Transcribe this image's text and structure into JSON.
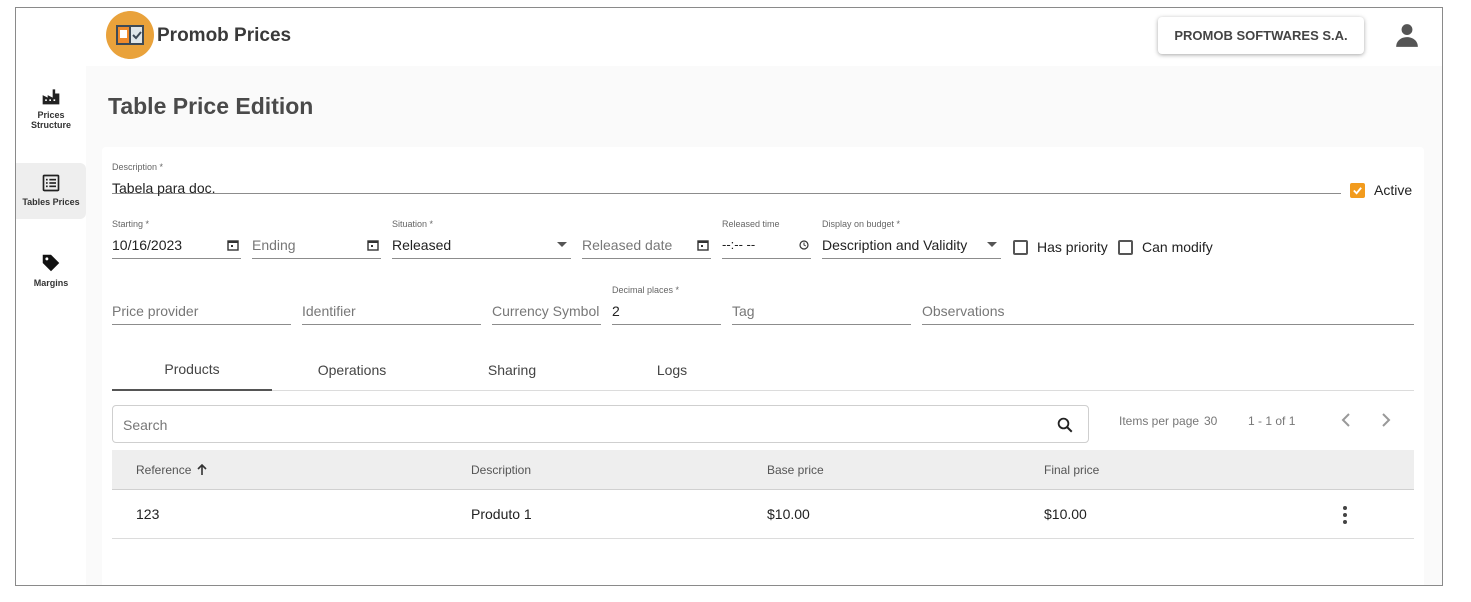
{
  "app": {
    "title": "Promob Prices",
    "company": "PROMOB SOFTWARES S.A."
  },
  "sidebar": {
    "items": [
      {
        "label": "Prices Structure",
        "icon": "factory-icon"
      },
      {
        "label": "Tables Prices",
        "icon": "list-icon"
      },
      {
        "label": "Margins",
        "icon": "tag-icon"
      }
    ]
  },
  "page": {
    "title": "Table Price Edition"
  },
  "form": {
    "description": {
      "label": "Description *",
      "value": "Tabela para doc."
    },
    "active": {
      "label": "Active",
      "checked": true
    },
    "starting": {
      "label": "Starting *",
      "value": "10/16/2023"
    },
    "ending": {
      "placeholder": "Ending"
    },
    "situation": {
      "label": "Situation *",
      "value": "Released"
    },
    "released_date": {
      "placeholder": "Released date"
    },
    "released_time": {
      "label": "Released time",
      "value": "--:-- --"
    },
    "display_on_budget": {
      "label": "Display on budget *",
      "value": "Description and Validity"
    },
    "has_priority": {
      "label": "Has priority",
      "checked": false
    },
    "can_modify": {
      "label": "Can modify",
      "checked": false
    },
    "price_provider": {
      "placeholder": "Price provider"
    },
    "identifier": {
      "placeholder": "Identifier"
    },
    "currency_symbol": {
      "placeholder": "Currency Symbol"
    },
    "decimal_places": {
      "label": "Decimal places *",
      "value": "2"
    },
    "tag": {
      "placeholder": "Tag"
    },
    "observations": {
      "placeholder": "Observations"
    }
  },
  "tabs": [
    {
      "label": "Products",
      "active": true
    },
    {
      "label": "Operations",
      "active": false
    },
    {
      "label": "Sharing",
      "active": false
    },
    {
      "label": "Logs",
      "active": false
    }
  ],
  "search": {
    "placeholder": "Search"
  },
  "pagination": {
    "items_per_page_label": "Items per page",
    "items_per_page": "30",
    "range": "1 - 1 of 1"
  },
  "table": {
    "columns": [
      "Reference",
      "Description",
      "Base price",
      "Final price"
    ],
    "rows": [
      {
        "reference": "123",
        "description": "Produto 1",
        "base_price": "$10.00",
        "final_price": "$10.00"
      }
    ]
  },
  "colors": {
    "accent": "#f29b1d",
    "logo": "#e9a23b"
  }
}
